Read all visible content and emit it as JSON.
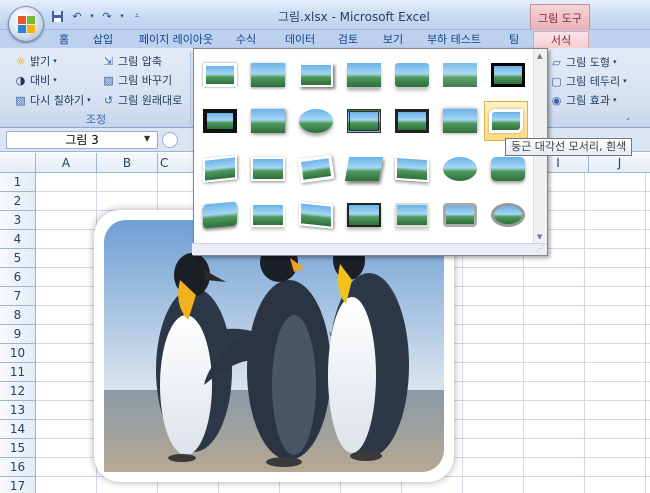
{
  "window": {
    "title": "그림.xlsx - Microsoft Excel",
    "context_tab_group": "그림 도구"
  },
  "tabs": [
    {
      "label": "홈"
    },
    {
      "label": "삽입"
    },
    {
      "label": "페이지 레이아웃"
    },
    {
      "label": "수식"
    },
    {
      "label": "데이터"
    },
    {
      "label": "검토"
    },
    {
      "label": "보기"
    },
    {
      "label": "부하 테스트"
    },
    {
      "label": "팀"
    },
    {
      "label": "서식"
    }
  ],
  "ribbon": {
    "adjust_group": {
      "label": "조정",
      "brightness": "밝기",
      "contrast": "대비",
      "recolor": "다시 칠하기",
      "compress": "그림 압축",
      "change_picture": "그림 바꾸기",
      "reset_picture": "그림 원래대로"
    },
    "picture_shape": "그림 도형",
    "picture_border": "그림 테두리",
    "picture_effects": "그림 효과"
  },
  "formula_bar": {
    "name_box": "그림 3"
  },
  "columns": [
    "A",
    "B",
    "C",
    "I",
    "J"
  ],
  "rows": [
    "1",
    "2",
    "3",
    "4",
    "5",
    "6",
    "7",
    "8",
    "9",
    "10",
    "11",
    "12",
    "13",
    "14",
    "15",
    "16",
    "17"
  ],
  "gallery": {
    "tooltip": "둥근 대각선 모서리, 흰색",
    "selected_index": 13
  },
  "colors": {
    "office_blue": "#bcd1ee",
    "context_pink": "#f5cdd2",
    "selection_gold": "#ffd97a"
  }
}
